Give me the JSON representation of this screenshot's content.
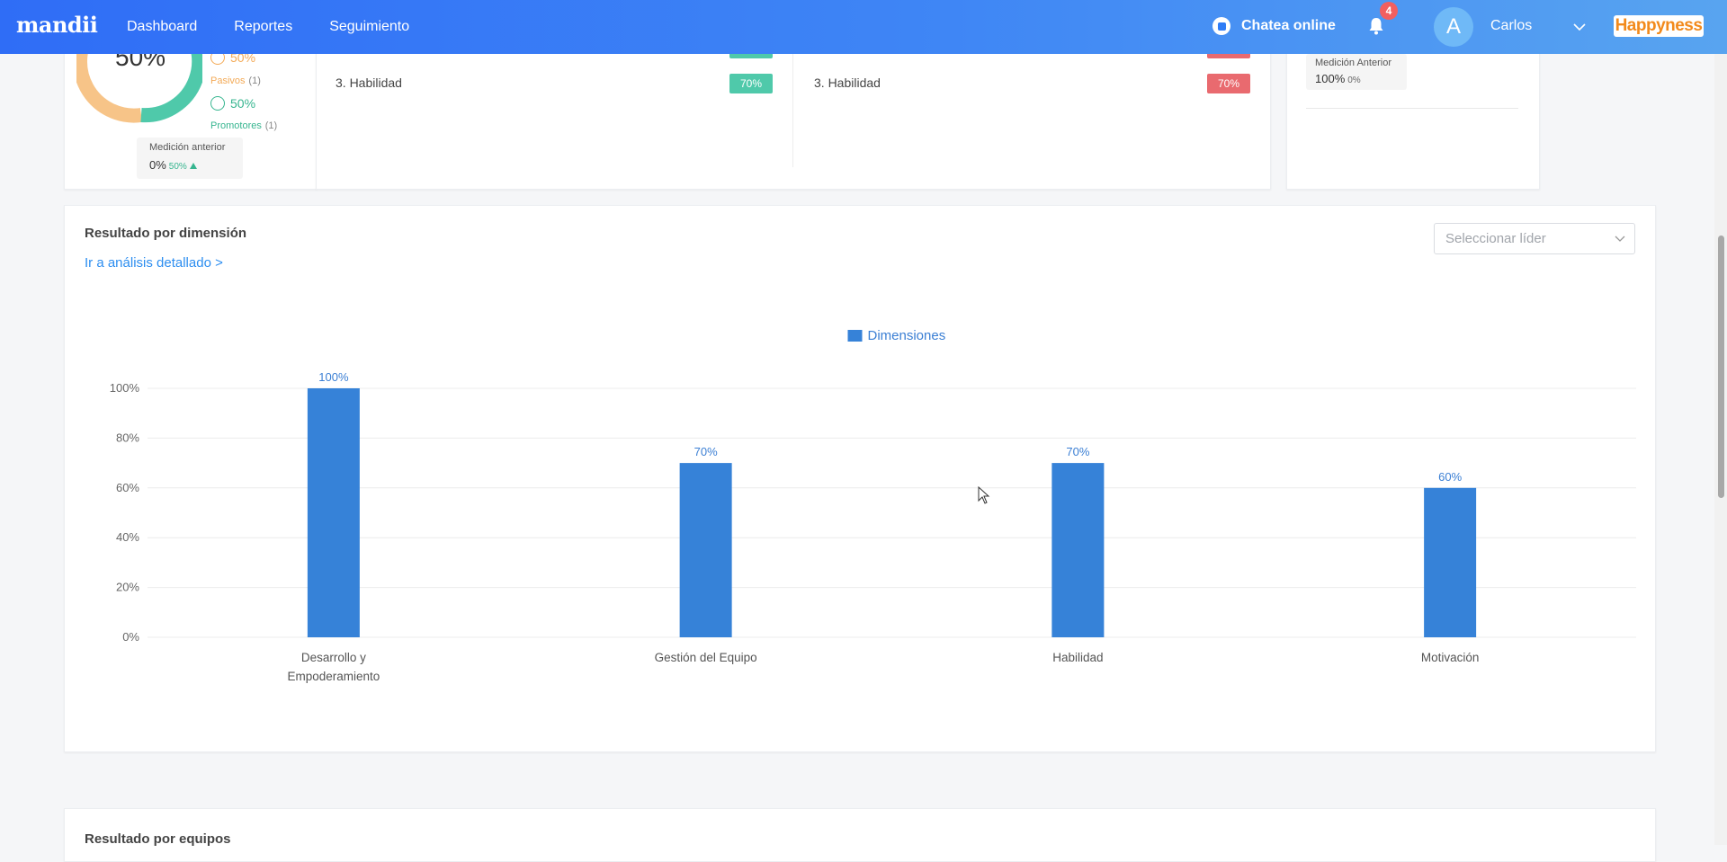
{
  "nav": {
    "logo": "mandii",
    "links": [
      "Dashboard",
      "Reportes",
      "Seguimiento"
    ],
    "chat_label": "Chatea online",
    "notification_count": "4",
    "avatar_initial": "A",
    "user_name": "Carlos",
    "brand": "Happyness"
  },
  "nps_card": {
    "score": "50%",
    "passives_pct": "50%",
    "passives_label": "Pasivos",
    "passives_count": "(1)",
    "promoters_pct": "50%",
    "promoters_label": "Promotores",
    "promoters_count": "(1)",
    "previous_label": "Medición anterior",
    "previous_value": "0%",
    "previous_delta": "50%",
    "colors": {
      "passives": "#f7b96b",
      "promoters": "#4fc9aa"
    }
  },
  "strengths_list": {
    "item_label": "3.  Habilidad",
    "item_value": "70%"
  },
  "weaknesses_list": {
    "item_label": "3.  Habilidad",
    "item_value": "70%"
  },
  "side_card": {
    "previous_label": "Medición Anterior",
    "previous_value": "100%",
    "previous_delta": "0%"
  },
  "dimension_section": {
    "title": "Resultado por dimensión",
    "detail_link": "Ir a análisis detallado >",
    "select_placeholder": "Seleccionar líder"
  },
  "chart_data": {
    "type": "bar",
    "categories": [
      "Desarrollo y Empoderamiento",
      "Gestión del Equipo",
      "Habilidad",
      "Motivación"
    ],
    "category_lines": [
      [
        "Desarrollo y",
        "Empoderamiento"
      ],
      [
        "Gestión del Equipo"
      ],
      [
        "Habilidad"
      ],
      [
        "Motivación"
      ]
    ],
    "series": [
      {
        "name": "Dimensiones",
        "values": [
          100,
          70,
          70,
          60
        ]
      }
    ],
    "data_labels": [
      "100%",
      "70%",
      "70%",
      "60%"
    ],
    "y_ticks": [
      "0%",
      "20%",
      "40%",
      "60%",
      "80%",
      "100%"
    ],
    "ylim": [
      0,
      100
    ],
    "grid": true,
    "legend": "top-center",
    "bar_color": "#3682d8"
  },
  "teams_section": {
    "title": "Resultado por equipos"
  }
}
